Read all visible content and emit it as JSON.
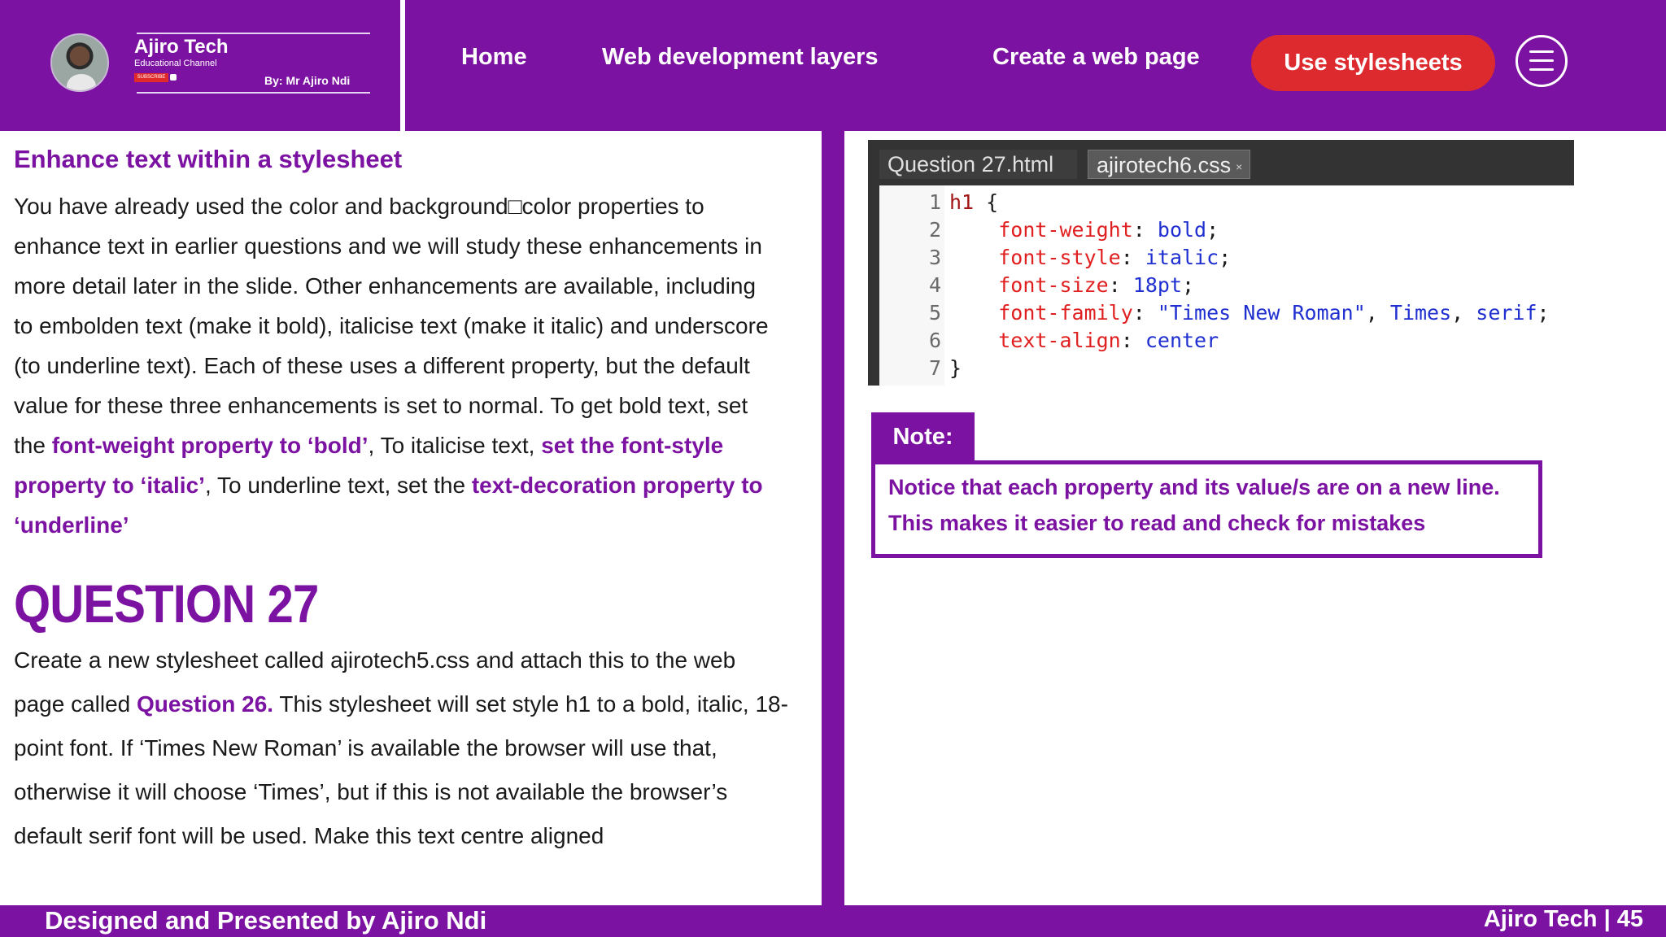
{
  "header": {
    "brand_name": "Ajiro Tech",
    "brand_sub": "Educational Channel",
    "subscribe": "SUBSCRIBE",
    "brand_by": "By: Mr Ajiro Ndi",
    "nav": {
      "home": "Home",
      "layers": "Web development layers",
      "create": "Create a web page",
      "active": "Use stylesheets"
    }
  },
  "left": {
    "section_title": "Enhance text within a stylesheet",
    "p1": {
      "l1": "You have already used the color and background□color properties to",
      "l2": "enhance text in earlier questions and we will study these enhancements in",
      "l3": "more detail later in the slide. Other enhancements are available, including",
      "l4": "to embolden text (make it bold), italicise text (make it italic) and underscore",
      "l5": "(to underline text). Each of these uses a different property, but the default",
      "l6": "value for these three enhancements is set to normal. To get bold text, set",
      "l7a": "the ",
      "l7b": "font-weight property to ‘bold’",
      "l7c": ", To italicise text, ",
      "l7d": "set the font-style",
      "l8a": "property to ‘italic’",
      "l8b": ", To underline text, set the ",
      "l8c": "text-decoration property to",
      "l9": "‘underline’"
    },
    "question_title": "QUESTION 27",
    "p2": {
      "l1": "Create a new stylesheet called ajirotech5.css and attach this to the web",
      "l2a": "page called ",
      "l2b": "Question 26.",
      "l2c": " This stylesheet will set style h1 to a bold, italic, 18-",
      "l3": "point font. If ‘Times New Roman’ is available the browser will use that,",
      "l4": "otherwise it will choose ‘Times’, but if this is not available the browser’s",
      "l5": "default serif font will be used. Make this text centre aligned"
    }
  },
  "editor": {
    "tabs": [
      "Question 27.html",
      "ajirotech6.css"
    ],
    "close_glyph": "×",
    "line_numbers": [
      "1",
      "2",
      "3",
      "4",
      "5",
      "6",
      "7"
    ],
    "code": {
      "l1_sel": "h1",
      "l1_brace": " {",
      "l2_prop": "font-weight",
      "l2_val": "bold",
      "l3_prop": "font-style",
      "l3_val": "italic",
      "l4_prop": "font-size",
      "l4_val": "18pt",
      "l5_prop": "font-family",
      "l5_val1": "\"Times New Roman\"",
      "l5_val2": "Times",
      "l5_val3": "serif",
      "l6_prop": "text-align",
      "l6_val": "center",
      "l7": "}"
    }
  },
  "note": {
    "label": "Note:",
    "line1": "Notice that each property and its value/s are on a new line.",
    "line2": "This makes it easier to read and check for mistakes"
  },
  "footer": {
    "left": "Designed and Presented by Ajiro Ndi",
    "right": "Ajiro Tech | 45"
  },
  "colors": {
    "brand_purple": "#7b12a1",
    "active_red": "#dd2a2f"
  }
}
